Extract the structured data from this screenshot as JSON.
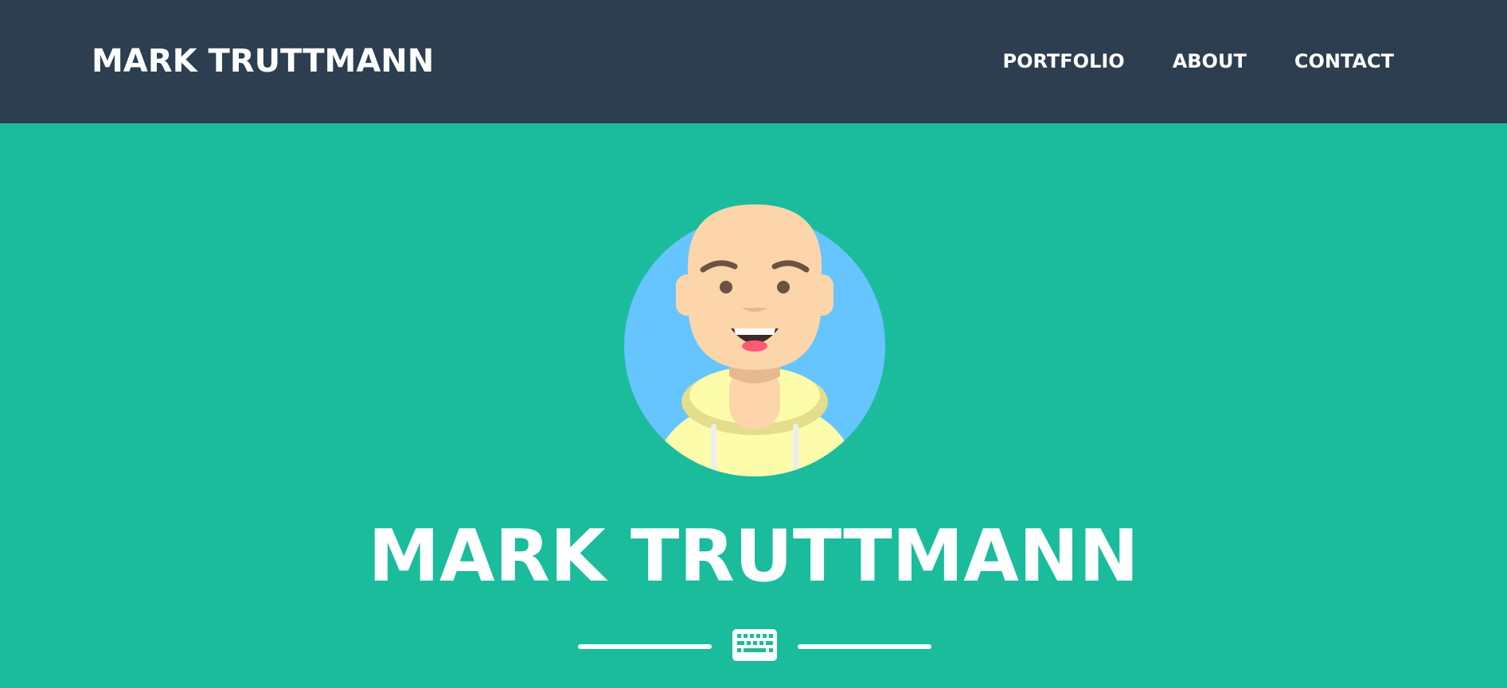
{
  "navbar": {
    "brand": "MARK TRUTTMANN",
    "links": [
      {
        "label": "PORTFOLIO"
      },
      {
        "label": "ABOUT"
      },
      {
        "label": "CONTACT"
      }
    ]
  },
  "masthead": {
    "heading": "MARK TRUTTMANN",
    "divider_icon": "keyboard-icon"
  },
  "colors": {
    "navbar_bg": "#2c3e50",
    "masthead_bg": "#1abc9c",
    "avatar_bg": "#66c4ff",
    "text": "#ffffff"
  }
}
